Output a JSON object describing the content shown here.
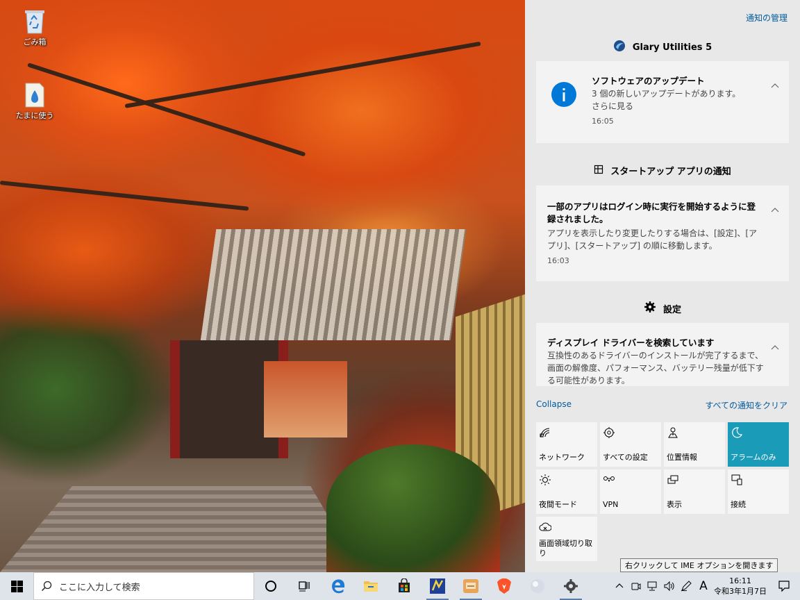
{
  "desktop": {
    "icons": [
      {
        "label": "ごみ箱",
        "icon": "recycle-bin-icon"
      },
      {
        "label": "たまに使う",
        "icon": "folder-icon"
      }
    ]
  },
  "action_center": {
    "manage_label": "通知の管理",
    "groups": [
      {
        "app_name": "Glary Utilities 5",
        "icon": "glary-utilities-icon",
        "notification": {
          "title": "ソフトウェアのアップデート",
          "body_line1": "3 個の新しいアップデートがあります。",
          "body_line2": "さらに見る",
          "time": "16:05"
        }
      },
      {
        "app_name": "スタートアップ アプリの通知",
        "icon": "startup-apps-icon",
        "notification": {
          "title": "一部のアプリはログイン時に実行を開始するように登録されました。",
          "body": "アプリを表示したり変更したりする場合は、[設定]、[アプリ]、[スタートアップ] の順に移動します。",
          "time": "16:03"
        }
      },
      {
        "app_name": "設定",
        "icon": "gear-icon",
        "notification": {
          "title": "ディスプレイ ドライバーを検索しています",
          "body": "互換性のあるドライバーのインストールが完了するまで、画面の解像度、パフォーマンス、バッテリー残量が低下する可能性があります。"
        }
      }
    ],
    "collapse_label": "Collapse",
    "clear_all_label": "すべての通知をクリア",
    "quick_actions": [
      {
        "label": "ネットワーク",
        "icon": "network-icon",
        "active": false
      },
      {
        "label": "すべての設定",
        "icon": "settings-gear-icon",
        "active": false
      },
      {
        "label": "位置情報",
        "icon": "location-icon",
        "active": false
      },
      {
        "label": "アラームのみ",
        "icon": "moon-icon",
        "active": true
      },
      {
        "label": "夜間モード",
        "icon": "sun-icon",
        "active": false
      },
      {
        "label": "VPN",
        "icon": "vpn-icon",
        "active": false
      },
      {
        "label": "表示",
        "icon": "project-icon",
        "active": false
      },
      {
        "label": "接続",
        "icon": "connect-icon",
        "active": false
      },
      {
        "label": "画面領域切り取り",
        "icon": "snip-icon",
        "active": false
      }
    ]
  },
  "tooltip": {
    "text": "右クリックして IME オプションを開きます"
  },
  "taskbar": {
    "search_placeholder": "ここに入力して検索",
    "pinned": [
      "cortana-icon",
      "task-view-icon",
      "edge-icon",
      "file-explorer-icon",
      "store-icon",
      "app-icon",
      "app-icon",
      "brave-icon",
      "app-icon",
      "settings-icon"
    ],
    "ime_label": "A",
    "clock_time": "16:11",
    "clock_date": "令和3年1月7日"
  },
  "colors": {
    "accent": "#1a9bb8",
    "link": "#005a9e",
    "info_blue": "#0078d7"
  }
}
